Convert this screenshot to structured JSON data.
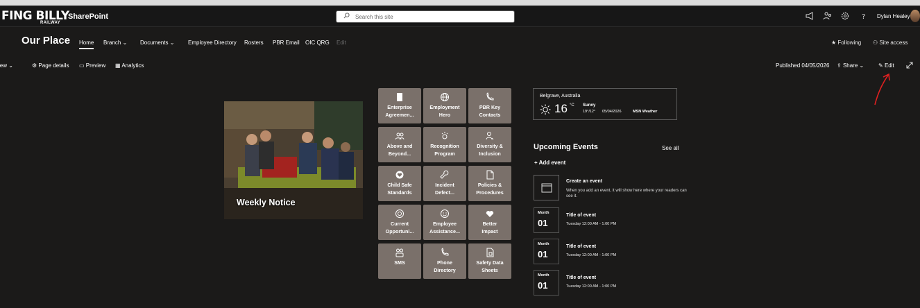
{
  "suite": {
    "logo_text": "FING BILLY",
    "logo_sub": "RAILWAY",
    "app_name": "SharePoint"
  },
  "search": {
    "placeholder": "Search this site"
  },
  "user": {
    "name": "Dylan Healey"
  },
  "site": {
    "title": "Our Place",
    "nav": [
      "Home",
      "Branch",
      "Documents",
      "Employee Directory",
      "Rosters",
      "PBR Email",
      "OIC QRG",
      "Edit"
    ],
    "following": "Following",
    "site_access": "Site access"
  },
  "command_bar": {
    "new": "New",
    "page_details": "Page details",
    "preview": "Preview",
    "analytics": "Analytics",
    "published": "Published 04/05/2026",
    "share": "Share",
    "edit": "Edit"
  },
  "hero": {
    "title": "Weekly Notice"
  },
  "tiles": [
    {
      "label": "Enterprise\nAgreemen...",
      "icon": "document-icon"
    },
    {
      "label": "Employment\nHero",
      "icon": "globe-icon"
    },
    {
      "label": "PBR Key\nContacts",
      "icon": "phone-icon"
    },
    {
      "label": "Above and\nBeyond...",
      "icon": "people-icon"
    },
    {
      "label": "Recognition\nProgram",
      "icon": "celebrate-icon"
    },
    {
      "label": "Diversity &\nInclusion",
      "icon": "person-icon"
    },
    {
      "label": "Child Safe\nStandards",
      "icon": "heart-circle-icon"
    },
    {
      "label": "Incident\nDefect...",
      "icon": "wrench-icon"
    },
    {
      "label": "Policies &\nProcedures",
      "icon": "page-icon"
    },
    {
      "label": "Current\nOpportuni...",
      "icon": "badge-icon"
    },
    {
      "label": "Employee\nAssistance...",
      "icon": "smiley-icon"
    },
    {
      "label": "Better\nImpact",
      "icon": "heart-icon"
    },
    {
      "label": "SMS",
      "icon": "team-icon"
    },
    {
      "label": "Phone\nDirectory",
      "icon": "phone-icon"
    },
    {
      "label": "Safety Data\nSheets",
      "icon": "sheet-icon"
    }
  ],
  "weather": {
    "location": "Belgrave, Australia",
    "temp": "16",
    "unit": "°C",
    "condition": "Sunny",
    "range": "19°/12°",
    "date": "05/04/2026",
    "source": "MSN Weather"
  },
  "events": {
    "heading": "Upcoming Events",
    "see_all": "See all",
    "add_event": "+ Add event",
    "create_title": "Create an event",
    "create_desc": "When you add an event, it will show here where your readers can see it.",
    "items": [
      {
        "month": "Month",
        "day": "01",
        "title": "Title of event",
        "time": "Tuesday 12:00 AM - 1:00 PM"
      },
      {
        "month": "Month",
        "day": "01",
        "title": "Title of event",
        "time": "Tuesday 12:00 AM - 1:00 PM"
      },
      {
        "month": "Month",
        "day": "01",
        "title": "Title of event",
        "time": "Tuesday 12:00 AM - 1:00 PM"
      }
    ]
  }
}
